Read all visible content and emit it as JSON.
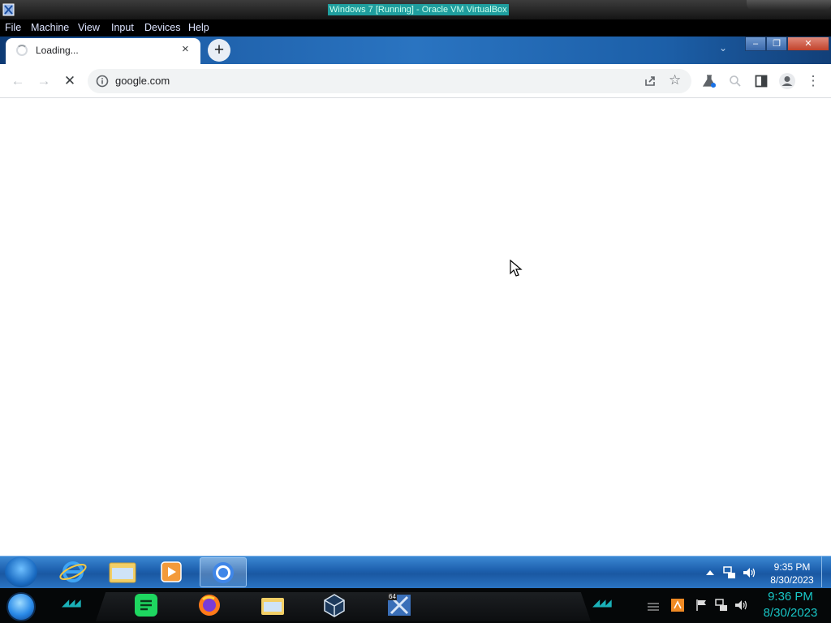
{
  "vbox": {
    "title": "Windows 7 [Running] - Oracle VM VirtualBox",
    "menu": [
      "File",
      "Machine",
      "View",
      "Input",
      "Devices",
      "Help"
    ]
  },
  "chrome": {
    "tab_title": "Loading...",
    "tab_close": "×",
    "new_tab": "+",
    "tab_search": "⌄",
    "url": "google.com",
    "window_controls": {
      "minimize": "–",
      "maximize": "❐",
      "close": "✕"
    },
    "toolbar": {
      "back": "←",
      "forward": "→",
      "stop": "✕",
      "star": "☆",
      "menu": "⋮"
    }
  },
  "guest_taskbar": {
    "time": "9:35 PM",
    "date": "8/30/2023",
    "tray_arrow": "▲"
  },
  "host_taskbar": {
    "time": "9:36 PM",
    "date": "8/30/2023",
    "virtualbox_badge": "64"
  },
  "colors": {
    "taskbar_blue": "#1d5fad",
    "host_clock": "#18c6c6",
    "vbox_title_highlight": "#1f9e9e"
  }
}
